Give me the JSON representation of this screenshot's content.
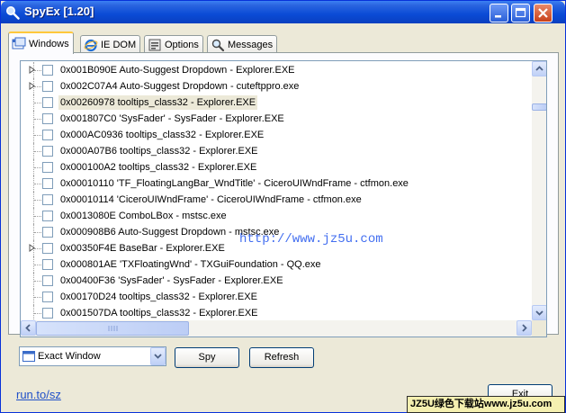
{
  "window": {
    "title": "SpyEx [1.20]"
  },
  "tabs": [
    {
      "label": "Windows",
      "icon": "windows-tab-icon",
      "active": true
    },
    {
      "label": "IE DOM",
      "icon": "ie-icon",
      "active": false
    },
    {
      "label": "Options",
      "icon": "options-icon",
      "active": false
    },
    {
      "label": "Messages",
      "icon": "magnifier-icon",
      "active": false
    }
  ],
  "tree": {
    "items": [
      {
        "text": "0x001B090E Auto-Suggest Dropdown - Explorer.EXE",
        "expandable": true
      },
      {
        "text": "0x002C07A4 Auto-Suggest Dropdown - cuteftppro.exe",
        "expandable": true
      },
      {
        "text": "0x00260978 tooltips_class32 - Explorer.EXE",
        "expandable": false,
        "selected": true
      },
      {
        "text": "0x001807C0 'SysFader' - SysFader - Explorer.EXE",
        "expandable": false
      },
      {
        "text": "0x000AC0936 tooltips_class32 - Explorer.EXE",
        "expandable": false
      },
      {
        "text": "0x000A07B6 tooltips_class32 - Explorer.EXE",
        "expandable": false
      },
      {
        "text": "0x000100A2 tooltips_class32 - Explorer.EXE",
        "expandable": false
      },
      {
        "text": "0x00010110 'TF_FloatingLangBar_WndTitle' - CiceroUIWndFrame - ctfmon.exe",
        "expandable": false
      },
      {
        "text": "0x00010114 'CiceroUIWndFrame' - CiceroUIWndFrame - ctfmon.exe",
        "expandable": false
      },
      {
        "text": "0x0013080E ComboLBox - mstsc.exe",
        "expandable": false
      },
      {
        "text": "0x000908B6 Auto-Suggest Dropdown - mstsc.exe",
        "expandable": false
      },
      {
        "text": "0x00350F4E BaseBar - Explorer.EXE",
        "expandable": true
      },
      {
        "text": "0x000801AE 'TXFloatingWnd' - TXGuiFoundation - QQ.exe",
        "expandable": false
      },
      {
        "text": "0x00400F36 'SysFader' - SysFader - Explorer.EXE",
        "expandable": false
      },
      {
        "text": "0x00170D24 tooltips_class32 - Explorer.EXE",
        "expandable": false
      },
      {
        "text": "0x001507DA tooltips_class32 - Explorer.EXE",
        "expandable": false
      }
    ],
    "vscroll_position": 0.12,
    "hscroll_position": 0.0
  },
  "controls": {
    "mode_select": "Exact Window",
    "spy_label": "Spy",
    "refresh_label": "Refresh"
  },
  "footer": {
    "link": "run.to/sz",
    "exit_label": "Exit"
  },
  "overlays": {
    "watermark": "http://www.jz5u.com",
    "badge": "JZ5U绿色下载站www.jz5u.com"
  },
  "colors": {
    "titlebar": "#0a4bd6",
    "selection": "#ece9d8",
    "link": "#2050c8",
    "tab_highlight": "#ffc83c"
  }
}
